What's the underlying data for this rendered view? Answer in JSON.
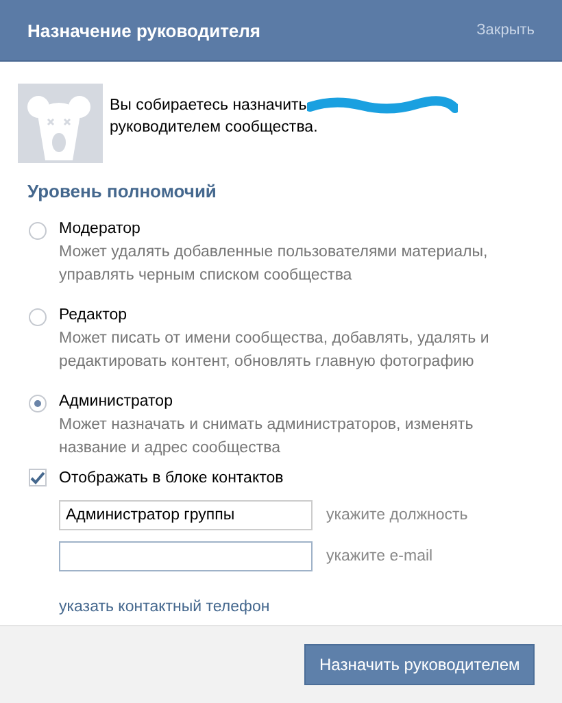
{
  "window": {
    "title": "Назначение руководителя",
    "close": "Закрыть"
  },
  "intro": {
    "before": "Вы собираетесь назначить",
    "after": "руководителем сообщества."
  },
  "section_title": "Уровень полномочий",
  "roles": [
    {
      "label": "Модератор",
      "description": "Может удалять добавленные пользователями материалы, управлять черным списком сообщества",
      "selected": false
    },
    {
      "label": "Редактор",
      "description": "Может писать от имени сообщества, добавлять, удалять и редактировать контент, обновлять главную фотографию",
      "selected": false
    },
    {
      "label": "Администратор",
      "description": "Может назначать и снимать администраторов, изменять название и адрес сообщества",
      "selected": true
    }
  ],
  "show_in_contacts": {
    "label": "Отображать в блоке контактов",
    "checked": true
  },
  "fields": [
    {
      "value": "Администратор группы",
      "hint": "укажите должность",
      "focused": false
    },
    {
      "hint": "укажите e-mail",
      "focused": true
    }
  ],
  "phone_link": "указать контактный телефон",
  "submit": "Назначить руководителем"
}
